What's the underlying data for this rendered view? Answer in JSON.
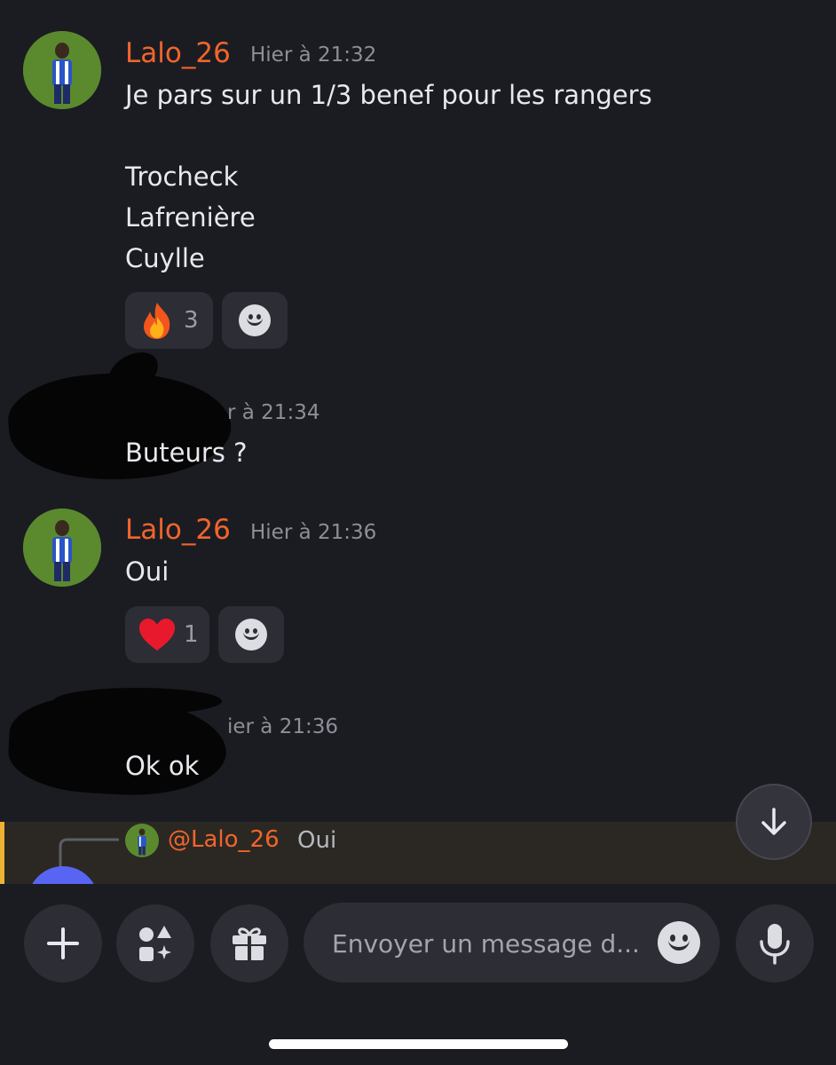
{
  "messages": [
    {
      "username": "Lalo_26",
      "timestamp": "Hier à 21:32",
      "lines": [
        "Je pars sur un 1/3 benef pour les rangers",
        "",
        "Trocheck",
        "Lafrenière",
        "Cuylle"
      ],
      "reaction": {
        "emoji": "fire-emoji",
        "count": "3"
      }
    },
    {
      "username": "",
      "timestamp": "r à 21:34",
      "lines": [
        "Buteurs ?"
      ]
    },
    {
      "username": "Lalo_26",
      "timestamp": "Hier à 21:36",
      "lines": [
        "Oui"
      ],
      "reaction": {
        "emoji": "heart-emoji",
        "count": "1"
      }
    },
    {
      "username": "",
      "timestamp": "ier à 21:36",
      "lines": [
        "Ok ok"
      ]
    }
  ],
  "reply_preview": {
    "mention": "@Lalo_26",
    "quoted_text": "Oui"
  },
  "composer": {
    "placeholder": "Envoyer un message d..."
  },
  "icons": {
    "add": "plus-icon",
    "apps": "apps-icon",
    "gift": "gift-icon",
    "emoji": "smiley-icon",
    "mic": "microphone-icon",
    "scroll": "arrow-down-icon"
  },
  "colors": {
    "background": "#1b1c22",
    "username": "#f0652c",
    "reply_highlight": "#2b2823",
    "reply_bar": "#f0b232",
    "button": "#2c2d35"
  }
}
